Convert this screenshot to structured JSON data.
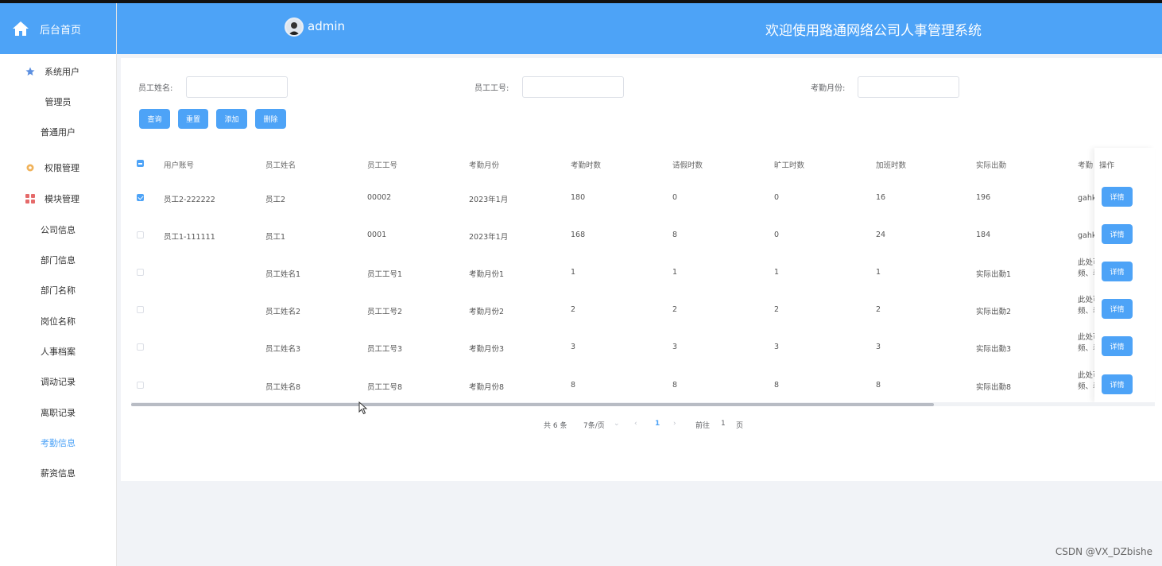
{
  "sidebar": {
    "home_label": "后台首页",
    "group1": {
      "label": "系统用户",
      "items": [
        "管理员",
        "普通用户"
      ]
    },
    "group2": {
      "label": "权限管理"
    },
    "group3": {
      "label": "模块管理",
      "items": [
        "公司信息",
        "部门信息",
        "部门名称",
        "岗位名称",
        "人事档案",
        "调动记录",
        "离职记录",
        "考勤信息",
        "薪资信息"
      ]
    },
    "active_item": "考勤信息"
  },
  "header": {
    "user": "admin",
    "title": "欢迎使用路通网络公司人事管理系统"
  },
  "search": {
    "name_label": "员工姓名:",
    "id_label": "员工工号:",
    "month_label": "考勤月份:",
    "name_value": "",
    "id_value": "",
    "month_value": ""
  },
  "toolbar": {
    "query": "查询",
    "reset": "重置",
    "add": "添加",
    "delete": "删除"
  },
  "table": {
    "headers": [
      "用户账号",
      "员工姓名",
      "员工工号",
      "考勤月份",
      "考勤时数",
      "请假时数",
      "旷工时数",
      "加班时数",
      "实际出勤",
      "考勤",
      "操作"
    ],
    "rows": [
      {
        "checked": true,
        "cells": [
          "员工2-222222",
          "员工2",
          "00002",
          "2023年1月",
          "180",
          "0",
          "0",
          "16",
          "196",
          "gahk"
        ],
        "action": "详情"
      },
      {
        "checked": false,
        "cells": [
          "员工1-111111",
          "员工1",
          "0001",
          "2023年1月",
          "168",
          "8",
          "0",
          "24",
          "184",
          "gahk"
        ],
        "action": "详情"
      },
      {
        "checked": false,
        "cells": [
          "",
          "员工姓名1",
          "员工工号1",
          "考勤月份1",
          "1",
          "1",
          "1",
          "1",
          "实际出勤1",
          "此处可\n频、表"
        ],
        "action": "详情"
      },
      {
        "checked": false,
        "cells": [
          "",
          "员工姓名2",
          "员工工号2",
          "考勤月份2",
          "2",
          "2",
          "2",
          "2",
          "实际出勤2",
          "此处可\n频、表"
        ],
        "action": "详情"
      },
      {
        "checked": false,
        "cells": [
          "",
          "员工姓名3",
          "员工工号3",
          "考勤月份3",
          "3",
          "3",
          "3",
          "3",
          "实际出勤3",
          "此处可\n频、表"
        ],
        "action": "详情"
      },
      {
        "checked": false,
        "cells": [
          "",
          "员工姓名8",
          "员工工号8",
          "考勤月份8",
          "8",
          "8",
          "8",
          "8",
          "实际出勤8",
          "此处可\n频、表"
        ],
        "action": "详情"
      }
    ]
  },
  "pagination": {
    "total": "共 6 条",
    "page_size": "7条/页",
    "current": "1",
    "goto_label": "前往",
    "goto_value": "1",
    "page_suffix": "页"
  },
  "watermark": "CSDN @VX_DZbishe",
  "colors": {
    "primary": "#4da3f7",
    "sidebar_bg": "#ffffff",
    "page_bg": "#f1f3f7"
  }
}
